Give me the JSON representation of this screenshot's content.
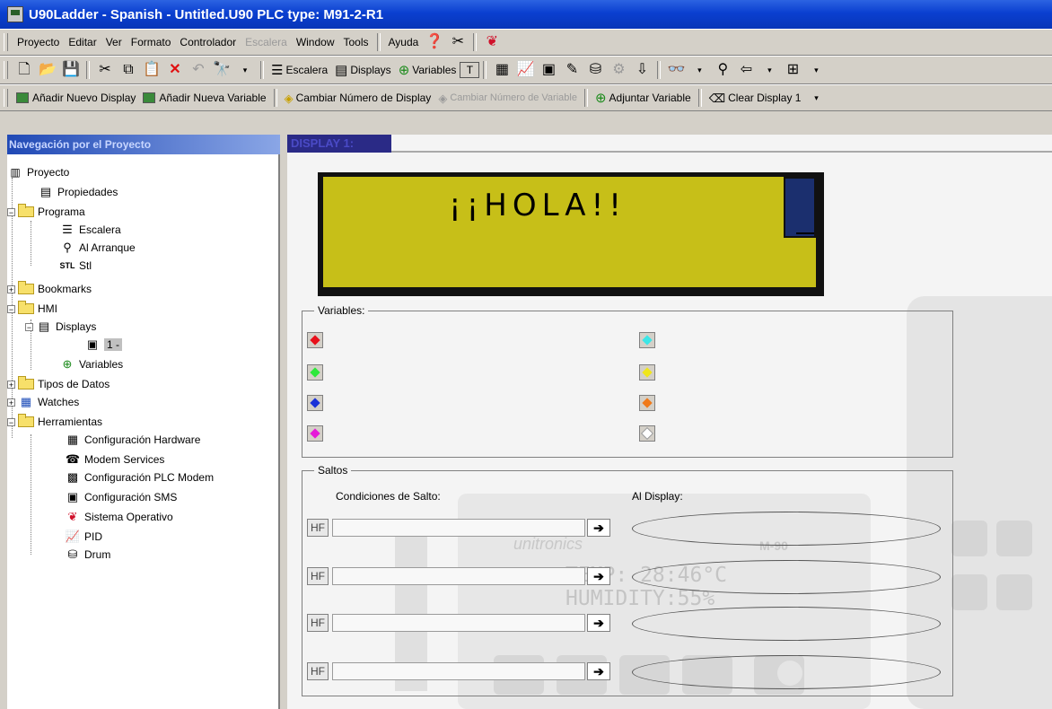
{
  "window": {
    "title": "U90Ladder - Spanish - Untitled.U90   PLC type: M91-2-R1"
  },
  "menu": {
    "items": [
      {
        "label": "Proyecto",
        "enabled": true
      },
      {
        "label": "Editar",
        "enabled": true
      },
      {
        "label": "Ver",
        "enabled": true
      },
      {
        "label": "Formato",
        "enabled": true
      },
      {
        "label": "Controlador",
        "enabled": true
      },
      {
        "label": "Escalera",
        "enabled": false
      },
      {
        "label": "Window",
        "enabled": true
      },
      {
        "label": "Tools",
        "enabled": true
      },
      {
        "label": "Ayuda",
        "enabled": true
      }
    ]
  },
  "toolbar1": {
    "escalera_label": "Escalera",
    "displays_label": "Displays",
    "variables_label": "Variables"
  },
  "toolbar2": {
    "add_display": "Añadir Nuevo Display",
    "add_variable": "Añadir Nueva Variable",
    "change_display_number": "Cambiar Número de Display",
    "change_variable_number": "Cambiar Número de Variable",
    "attach_variable": "Adjuntar Variable",
    "clear_display": "Clear Display 1"
  },
  "nav": {
    "header": "Navegación por el Proyecto",
    "tree": {
      "proyecto": "Proyecto",
      "propiedades": "Propiedades",
      "programa": "Programa",
      "escalera": "Escalera",
      "al_arranque": "Al Arranque",
      "stl": "Stl",
      "bookmarks": "Bookmarks",
      "hmi": "HMI",
      "displays": "Displays",
      "display_1": "1 -",
      "variables": "Variables",
      "tipos_de_datos": "Tipos de Datos",
      "watches": "Watches",
      "herramientas": "Herramientas",
      "config_hardware": "Configuración Hardware",
      "modem_services": "Modem Services",
      "config_plc_modem": "Configuración PLC Modem",
      "config_sms": "Configuración SMS",
      "sistema_operativo": "Sistema Operativo",
      "pid": "PID",
      "drum": "Drum"
    }
  },
  "editor": {
    "tab_label": "DISPLAY 1:",
    "lcd_text": "¡¡HOLA!!",
    "background_lines": [
      "TEMP: 28:46°C",
      "HUMIDITY:55%"
    ],
    "background_logo": "unitronics",
    "background_model": "M-90",
    "variables_legend": "Variables:",
    "variable_colors": [
      "#e8101a",
      "#2de83a",
      "#1a32d8",
      "#e61ad8",
      "#3de6e6",
      "#f0e61a",
      "#f07a1a",
      "#ffffff"
    ],
    "jumps_legend": "Saltos",
    "jump_conditions_header": "Condiciones de Salto:",
    "to_display_header": "Al Display:",
    "jump_contact_symbol": "HF",
    "jump_arrow": "➔"
  }
}
